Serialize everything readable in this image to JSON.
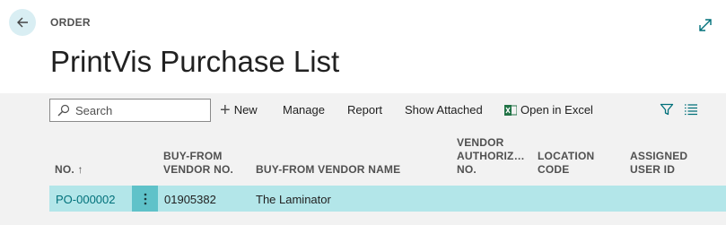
{
  "header": {
    "breadcrumb": "ORDER",
    "title": "PrintVis Purchase List"
  },
  "toolbar": {
    "search_placeholder": "Search",
    "new_label": "New",
    "manage_label": "Manage",
    "report_label": "Report",
    "show_attached_label": "Show Attached",
    "open_excel_label": "Open in Excel"
  },
  "columns": {
    "no": "NO. ↑",
    "vendor_no_line1": "BUY-FROM",
    "vendor_no_line2": "VENDOR NO.",
    "vendor_name": "BUY-FROM VENDOR NAME",
    "auth_line1": "VENDOR",
    "auth_line2": "AUTHORIZ…",
    "auth_line3": "NO.",
    "location_line1": "LOCATION",
    "location_line2": "CODE",
    "user_line1": "ASSIGNED",
    "user_line2": "USER ID"
  },
  "rows": [
    {
      "no": "PO-000002",
      "vendor_no": "01905382",
      "vendor_name": "The Laminator",
      "vendor_authorization_no": "",
      "location_code": "",
      "assigned_user_id": ""
    }
  ],
  "colors": {
    "accent": "#00707a",
    "selected_row": "#b3e6e9",
    "row_menu": "#5fc2c9",
    "excel_green": "#217346"
  }
}
